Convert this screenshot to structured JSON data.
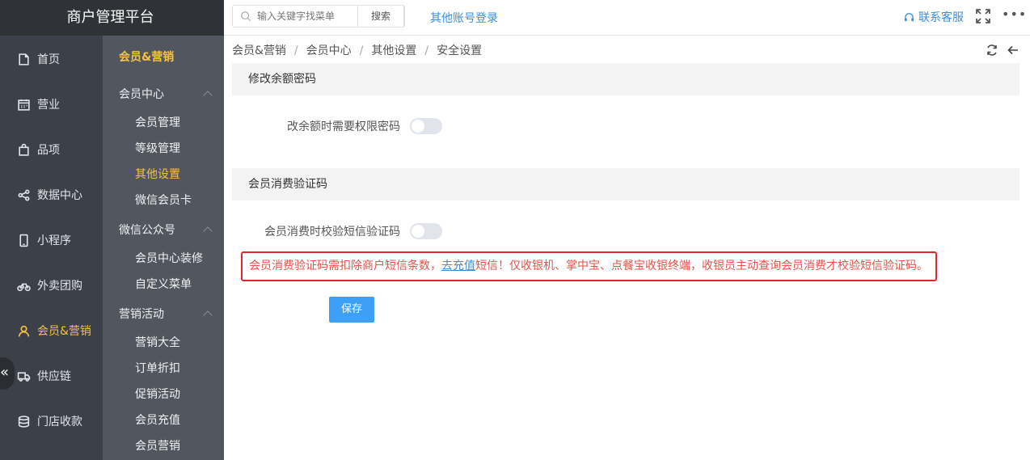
{
  "app": {
    "title": "商户管理平台"
  },
  "nav": {
    "items": [
      {
        "label": "首页",
        "icon": "home-icon"
      },
      {
        "label": "营业",
        "icon": "calendar-icon"
      },
      {
        "label": "品项",
        "icon": "bag-icon"
      },
      {
        "label": "数据中心",
        "icon": "share-icon"
      },
      {
        "label": "小程序",
        "icon": "phone-icon"
      },
      {
        "label": "外卖团购",
        "icon": "bike-icon"
      },
      {
        "label": "会员&营销",
        "icon": "user-icon",
        "active": true
      },
      {
        "label": "供应链",
        "icon": "truck-icon"
      },
      {
        "label": "门店收款",
        "icon": "coins-icon"
      }
    ],
    "collapse_glyph": "«"
  },
  "subnav": {
    "title": "会员&营销",
    "groups": [
      {
        "label": "会员中心",
        "items": [
          "会员管理",
          "等级管理",
          "其他设置",
          "微信会员卡"
        ]
      },
      {
        "label": "微信公众号",
        "items": [
          "会员中心装修",
          "自定义菜单"
        ]
      },
      {
        "label": "营销活动",
        "items": [
          "营销大全",
          "订单折扣",
          "促销活动",
          "会员充值",
          "会员营销"
        ]
      }
    ],
    "active_item": "其他设置"
  },
  "topbar": {
    "search_placeholder": "输入关键字找菜单",
    "search_button": "搜索",
    "other_login": "其他账号登录",
    "contact": "联系客服",
    "more": "•••"
  },
  "breadcrumb": [
    "会员&营销",
    "会员中心",
    "其他设置",
    "安全设置"
  ],
  "sections": {
    "balance": {
      "title": "修改余额密码",
      "label": "改余额时需要权限密码",
      "enabled": false
    },
    "verify": {
      "title": "会员消费验证码",
      "label": "会员消费时校验短信验证码",
      "enabled": false
    }
  },
  "notice": {
    "before": "会员消费验证码需扣除商户短信条数，",
    "link": "去充值",
    "after": "短信！仅收银机、掌中宝、点餐宝收银终端，收银员主动查询会员消费才校验短信验证码。"
  },
  "save_label": "保存",
  "colors": {
    "accent": "#f5c343",
    "link": "#3c8ddc",
    "primary": "#3d9ff5",
    "warning_border": "#e0252b"
  }
}
